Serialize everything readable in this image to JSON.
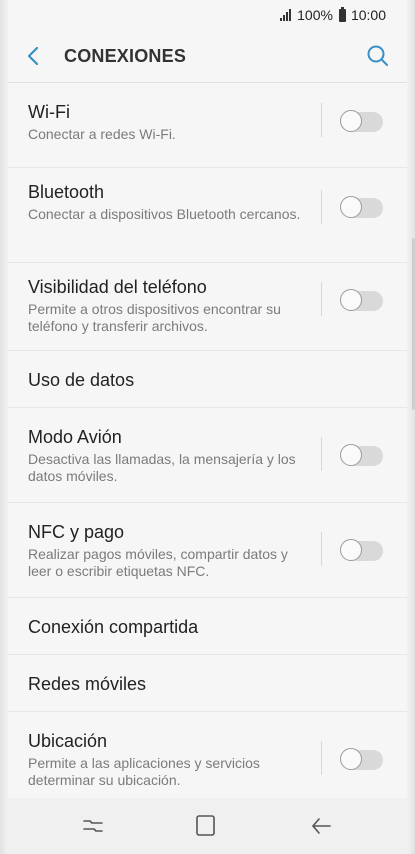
{
  "status": {
    "battery": "100%",
    "time": "10:00"
  },
  "header": {
    "title": "CONEXIONES"
  },
  "items": [
    {
      "label": "Wi-Fi",
      "desc": "Conectar a redes Wi-Fi.",
      "toggle": false
    },
    {
      "label": "Bluetooth",
      "desc": "Conectar a dispositivos Bluetooth cercanos.",
      "toggle": false
    },
    {
      "label": "Visibilidad del teléfono",
      "desc": "Permite a otros dispositivos encontrar su teléfono y transferir archivos.",
      "toggle": false
    },
    {
      "label": "Uso de datos"
    },
    {
      "label": "Modo Avión",
      "desc": "Desactiva las llamadas, la mensajería y los datos móviles.",
      "toggle": false
    },
    {
      "label": "NFC y pago",
      "desc": "Realizar pagos móviles, compartir datos y leer o escribir etiquetas NFC.",
      "toggle": false
    },
    {
      "label": "Conexión compartida"
    },
    {
      "label": "Redes móviles"
    },
    {
      "label": "Ubicación",
      "desc": "Permite a las aplicaciones y servicios determinar su ubicación.",
      "toggle": false
    }
  ],
  "colors": {
    "accent": "#3a8fc4",
    "background": "#f6f6f6",
    "text": "#222222",
    "secondary_text": "#7b7b7b"
  },
  "icons": {
    "back": "back-arrow-icon",
    "search": "search-icon",
    "recents": "recents-icon",
    "home": "home-icon",
    "nav_back": "nav-back-icon"
  }
}
